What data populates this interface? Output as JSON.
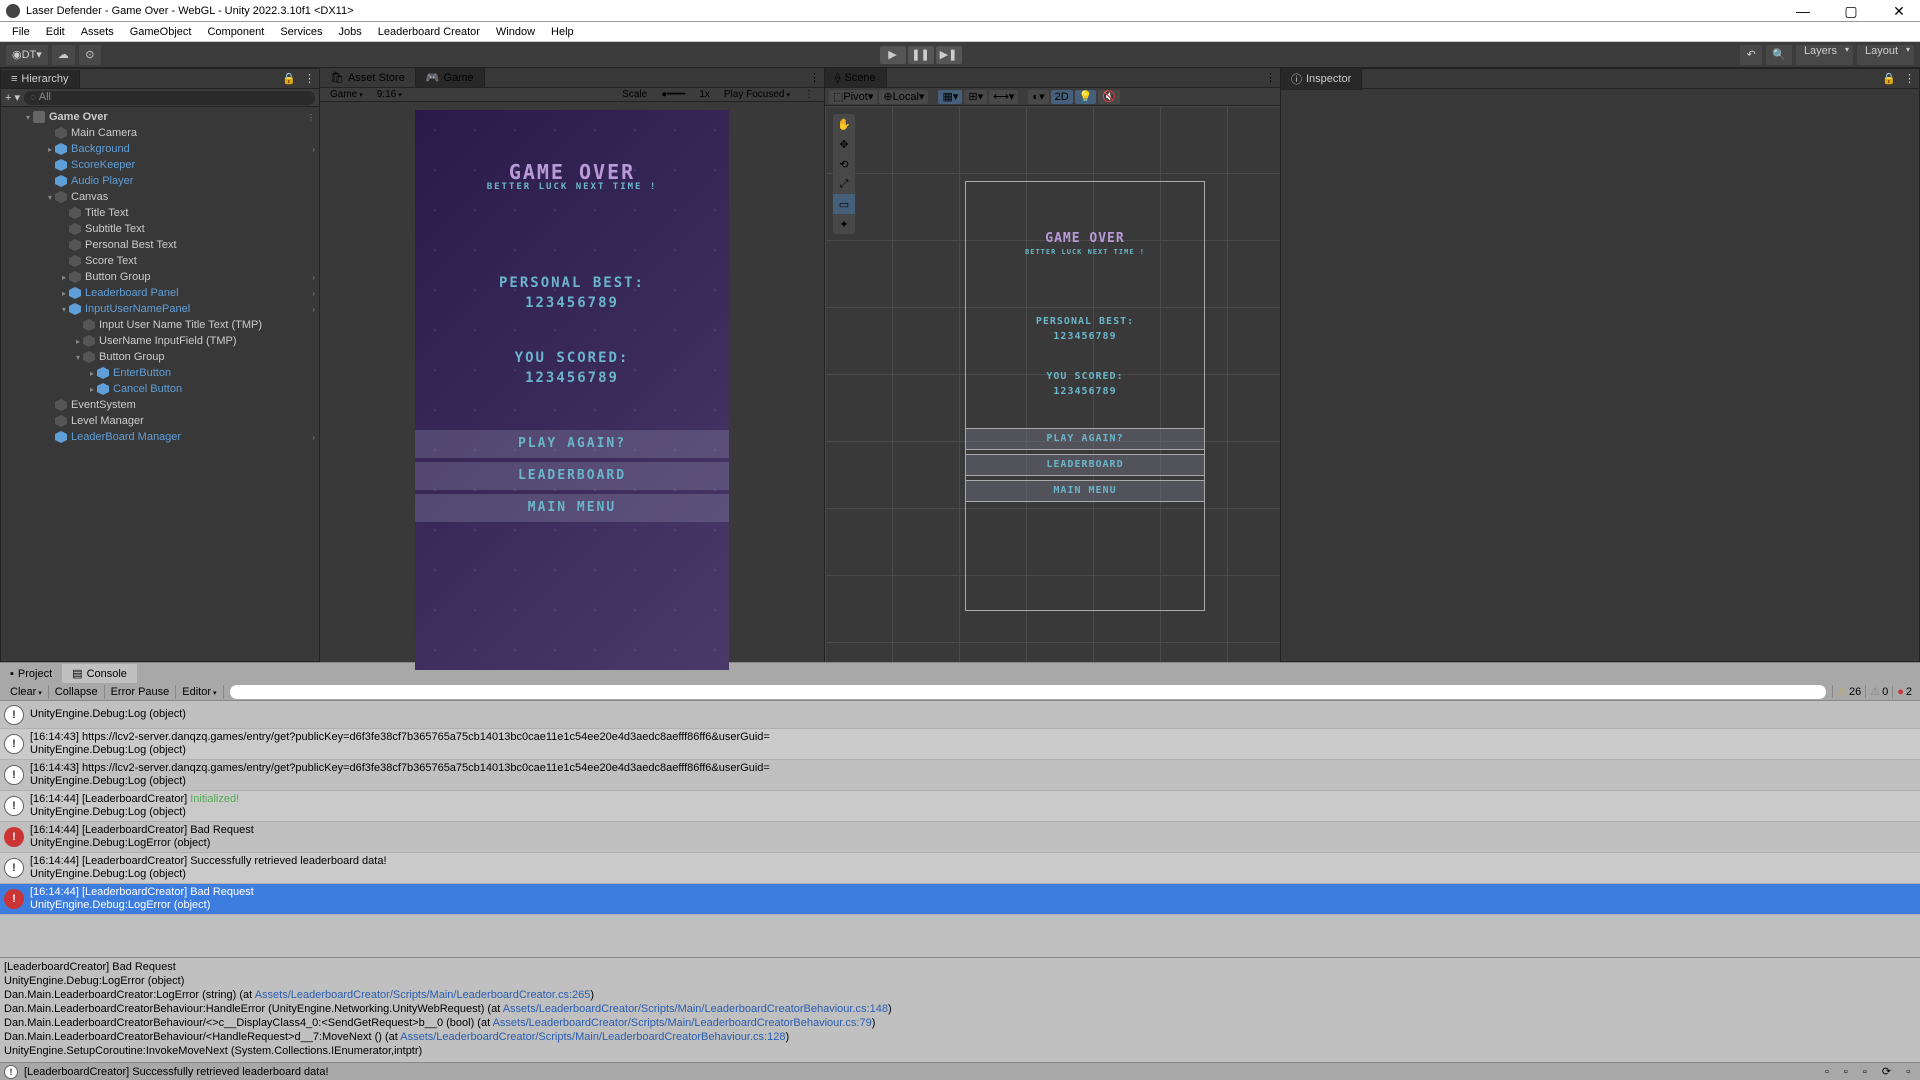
{
  "window": {
    "title": "Laser Defender - Game Over - WebGL - Unity 2022.3.10f1 <DX11>"
  },
  "menu": [
    "File",
    "Edit",
    "Assets",
    "GameObject",
    "Component",
    "Services",
    "Jobs",
    "Leaderboard Creator",
    "Window",
    "Help"
  ],
  "toolbar": {
    "account": "DT",
    "layers": "Layers",
    "layout": "Layout"
  },
  "hierarchy": {
    "title": "Hierarchy",
    "search_placeholder": "All",
    "scene": "Game Over",
    "items": [
      {
        "d": 1,
        "n": "Main Camera",
        "e": "",
        "b": false
      },
      {
        "d": 1,
        "n": "Background",
        "e": "▸",
        "b": true,
        "a": true
      },
      {
        "d": 1,
        "n": "ScoreKeeper",
        "e": "",
        "b": true
      },
      {
        "d": 1,
        "n": "Audio Player",
        "e": "",
        "b": true
      },
      {
        "d": 1,
        "n": "Canvas",
        "e": "▾",
        "b": false
      },
      {
        "d": 2,
        "n": "Title Text",
        "e": "",
        "b": false
      },
      {
        "d": 2,
        "n": "Subtitle Text",
        "e": "",
        "b": false
      },
      {
        "d": 2,
        "n": "Personal Best Text",
        "e": "",
        "b": false
      },
      {
        "d": 2,
        "n": "Score Text",
        "e": "",
        "b": false
      },
      {
        "d": 2,
        "n": "Button Group",
        "e": "▸",
        "b": false,
        "a": true
      },
      {
        "d": 2,
        "n": "Leaderboard Panel",
        "e": "▸",
        "b": true,
        "a": true
      },
      {
        "d": 2,
        "n": "InputUserNamePanel",
        "e": "▾",
        "b": true,
        "a": true
      },
      {
        "d": 3,
        "n": "Input User Name Title Text (TMP)",
        "e": "",
        "b": false
      },
      {
        "d": 3,
        "n": "UserName InputField (TMP)",
        "e": "▸",
        "b": false
      },
      {
        "d": 3,
        "n": "Button Group",
        "e": "▾",
        "b": false
      },
      {
        "d": 4,
        "n": "EnterButton",
        "e": "▸",
        "b": true
      },
      {
        "d": 4,
        "n": "Cancel Button",
        "e": "▸",
        "b": true
      },
      {
        "d": 1,
        "n": "EventSystem",
        "e": "",
        "b": false
      },
      {
        "d": 1,
        "n": "Level Manager",
        "e": "",
        "b": false
      },
      {
        "d": 1,
        "n": "LeaderBoard Manager",
        "e": "",
        "b": true,
        "a": true
      }
    ]
  },
  "gameTab": {
    "asset": "Asset Store",
    "game": "Game",
    "display": "Game",
    "aspect": "9:16",
    "scale": "Scale",
    "scaleVal": "1x",
    "focus": "Play Focused"
  },
  "sceneTab": {
    "title": "Scene",
    "pivot": "Pivot",
    "local": "Local",
    "twoD": "2D"
  },
  "gameContent": {
    "title": "GAME OVER",
    "subtitle": "BETTER LUCK NEXT TIME !",
    "pb_label": "PERSONAL BEST:",
    "pb_value": "123456789",
    "score_label": "YOU SCORED:",
    "score_value": "123456789",
    "btn1": "PLAY AGAIN?",
    "btn2": "LEADERBOARD",
    "btn3": "MAIN MENU"
  },
  "inspector": {
    "title": "Inspector"
  },
  "bottom": {
    "project": "Project",
    "console": "Console",
    "clear": "Clear",
    "collapse": "Collapse",
    "errorPause": "Error Pause",
    "editor": "Editor",
    "warn_count": "26",
    "info_count": "0",
    "err_count": "2"
  },
  "logs": [
    {
      "t": "info",
      "l1": "UnityEngine.Debug:Log (object)",
      "l2": ""
    },
    {
      "t": "info",
      "l1": "[16:14:43] https://lcv2-server.danqzq.games/entry/get?publicKey=d6f3fe38cf7b365765a75cb14013bc0cae11e1c54ee20e4d3aedc8aefff86ff6&userGuid=",
      "l2": "UnityEngine.Debug:Log (object)"
    },
    {
      "t": "info",
      "l1": "[16:14:43] https://lcv2-server.danqzq.games/entry/get?publicKey=d6f3fe38cf7b365765a75cb14013bc0cae11e1c54ee20e4d3aedc8aefff86ff6&userGuid=",
      "l2": "UnityEngine.Debug:Log (object)"
    },
    {
      "t": "info",
      "l1": "[16:14:44] [LeaderboardCreator] ",
      "l1b": "Initialized!",
      "l2": "UnityEngine.Debug:Log (object)"
    },
    {
      "t": "err",
      "l1": "[16:14:44] [LeaderboardCreator] Bad Request",
      "l2": "UnityEngine.Debug:LogError (object)"
    },
    {
      "t": "info",
      "l1": "[16:14:44] [LeaderboardCreator] Successfully retrieved leaderboard data!",
      "l2": "UnityEngine.Debug:Log (object)"
    },
    {
      "t": "err",
      "sel": true,
      "l1": "[16:14:44] [LeaderboardCreator] Bad Request",
      "l2": "UnityEngine.Debug:LogError (object)"
    }
  ],
  "detail": {
    "l1": "[LeaderboardCreator] Bad Request",
    "l2": "UnityEngine.Debug:LogError (object)",
    "l3a": "Dan.Main.LeaderboardCreator:LogError (string) (at ",
    "l3b": "Assets/LeaderboardCreator/Scripts/Main/LeaderboardCreator.cs:265",
    "l3c": ")",
    "l4a": "Dan.Main.LeaderboardCreatorBehaviour:HandleError (UnityEngine.Networking.UnityWebRequest) (at ",
    "l4b": "Assets/LeaderboardCreator/Scripts/Main/LeaderboardCreatorBehaviour.cs:148",
    "l4c": ")",
    "l5a": "Dan.Main.LeaderboardCreatorBehaviour/<>c__DisplayClass4_0:<SendGetRequest>b__0 (bool) (at ",
    "l5b": "Assets/LeaderboardCreator/Scripts/Main/LeaderboardCreatorBehaviour.cs:79",
    "l5c": ")",
    "l6a": "Dan.Main.LeaderboardCreatorBehaviour/<HandleRequest>d__7:MoveNext () (at ",
    "l6b": "Assets/LeaderboardCreator/Scripts/Main/LeaderboardCreatorBehaviour.cs:128",
    "l6c": ")",
    "l7": "UnityEngine.SetupCoroutine:InvokeMoveNext (System.Collections.IEnumerator,intptr)"
  },
  "status": "[LeaderboardCreator] Successfully retrieved leaderboard data!"
}
